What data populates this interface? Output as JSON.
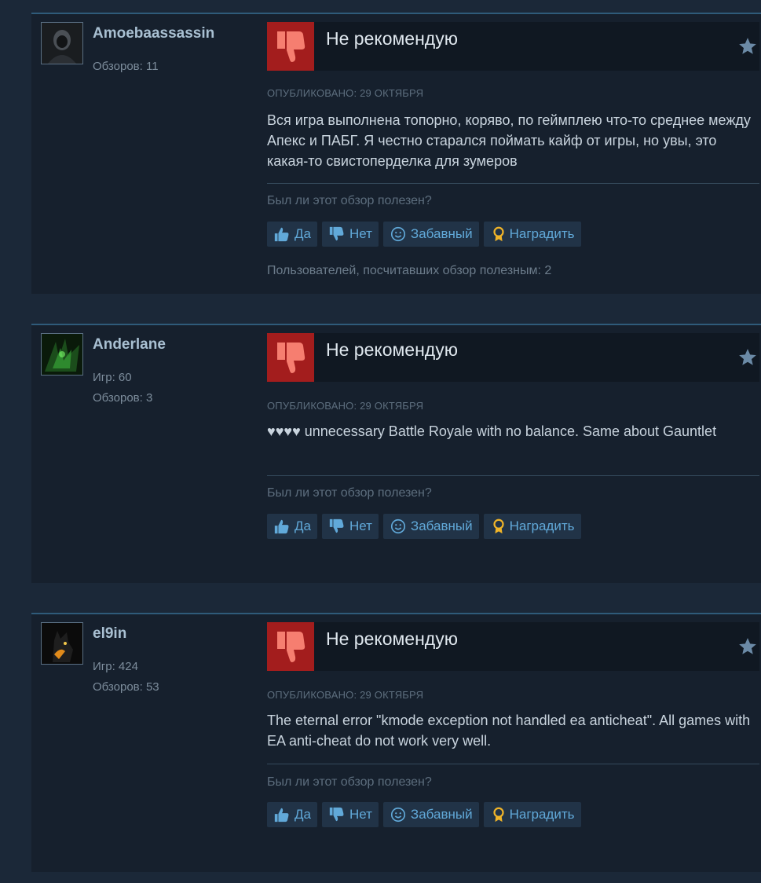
{
  "reviews": [
    {
      "author": "Amoebaassassin",
      "stats": [
        "Обзоров: 11"
      ],
      "verdict": "Не рекомендую",
      "posted": "ОПУБЛИКОВАНО: 29 ОКТЯБРЯ",
      "text": "Вся игра выполнена топорно, коряво, по геймплею что-то среднее между Апекс и ПАБГ. Я честно старался поймать кайф от игры, но увы, это какая-то свистоперделка для зумеров",
      "helpful_question": "Был ли этот обзор полезен?",
      "buttons": {
        "yes": "Да",
        "no": "Нет",
        "funny": "Забавный",
        "award": "Наградить"
      },
      "helpful_count": "Пользователей, посчитавших обзор полезным: 2"
    },
    {
      "author": "Anderlane",
      "stats": [
        "Игр: 60",
        "Обзоров: 3"
      ],
      "verdict": "Не рекомендую",
      "posted": "ОПУБЛИКОВАНО: 29 ОКТЯБРЯ",
      "text": "♥♥♥♥ unnecessary Battle Royale with no balance. Same about Gauntlet",
      "helpful_question": "Был ли этот обзор полезен?",
      "buttons": {
        "yes": "Да",
        "no": "Нет",
        "funny": "Забавный",
        "award": "Наградить"
      }
    },
    {
      "author": "el9in",
      "stats": [
        "Игр: 424",
        "Обзоров: 53"
      ],
      "verdict": "Не рекомендую",
      "posted": "ОПУБЛИКОВАНО: 29 ОКТЯБРЯ",
      "text": "The eternal error \"kmode exception not handled ea anticheat\". All games with EA anti-cheat do not work very well.",
      "helpful_question": "Был ли этот обзор полезен?",
      "buttons": {
        "yes": "Да",
        "no": "Нет",
        "funny": "Забавный",
        "award": "Наградить"
      }
    }
  ],
  "icons": {
    "verdict": "thumbs-down-icon",
    "favorite": "star-icon",
    "yes": "thumbs-up-icon",
    "no": "thumbs-down-icon",
    "funny": "smiley-icon",
    "award": "award-medal-icon"
  },
  "colors": {
    "background": "#1b2838",
    "card": "#16202d",
    "negative": "#a31d1d",
    "link": "#61a9d9",
    "author": "#a9c0d2"
  }
}
